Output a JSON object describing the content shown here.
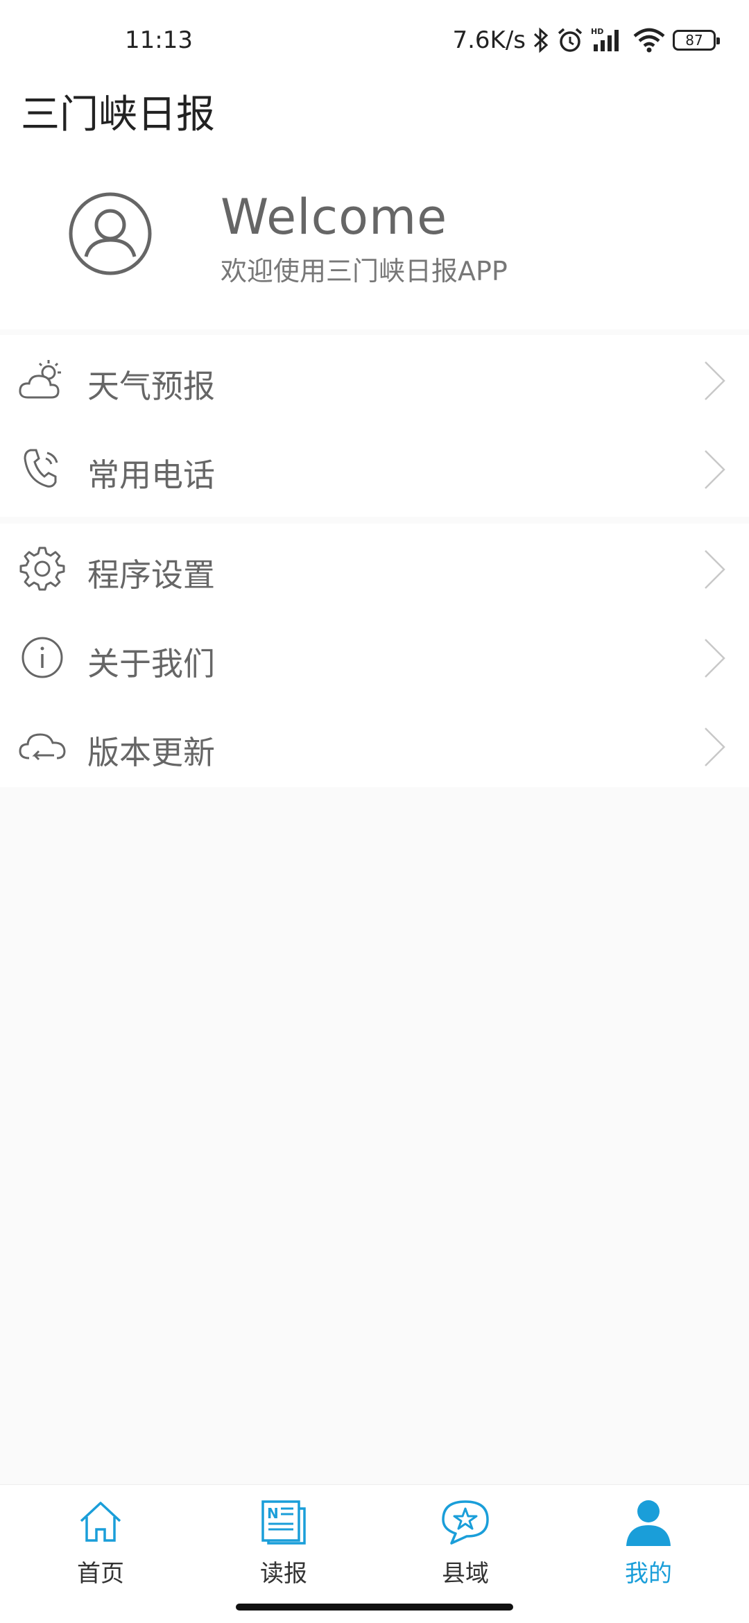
{
  "status_bar": {
    "time": "11:13",
    "net_speed": "7.6K/s",
    "battery": "87",
    "icons": [
      "bluetooth-icon",
      "alarm-icon",
      "hd-signal-icon",
      "wifi-icon",
      "battery-icon"
    ]
  },
  "header": {
    "title": "三门峡日报"
  },
  "profile": {
    "title": "Welcome",
    "subtitle": "欢迎使用三门峡日报APP"
  },
  "menu_groups": [
    {
      "items": [
        {
          "label": "天气预报",
          "icon": "weather-icon"
        },
        {
          "label": "常用电话",
          "icon": "phone-icon"
        }
      ]
    },
    {
      "items": [
        {
          "label": "程序设置",
          "icon": "gear-icon"
        },
        {
          "label": "关于我们",
          "icon": "info-icon"
        },
        {
          "label": "版本更新",
          "icon": "cloud-sync-icon"
        }
      ]
    }
  ],
  "bottom_nav": {
    "items": [
      {
        "label": "首页",
        "icon": "home-icon",
        "active": false
      },
      {
        "label": "读报",
        "icon": "newspaper-icon",
        "active": false
      },
      {
        "label": "县域",
        "icon": "star-chat-icon",
        "active": false
      },
      {
        "label": "我的",
        "icon": "user-icon",
        "active": true
      }
    ]
  },
  "colors": {
    "accent": "#1a9ed9",
    "text_primary": "#222222",
    "text_secondary": "#666666",
    "background": "#fafafa"
  }
}
